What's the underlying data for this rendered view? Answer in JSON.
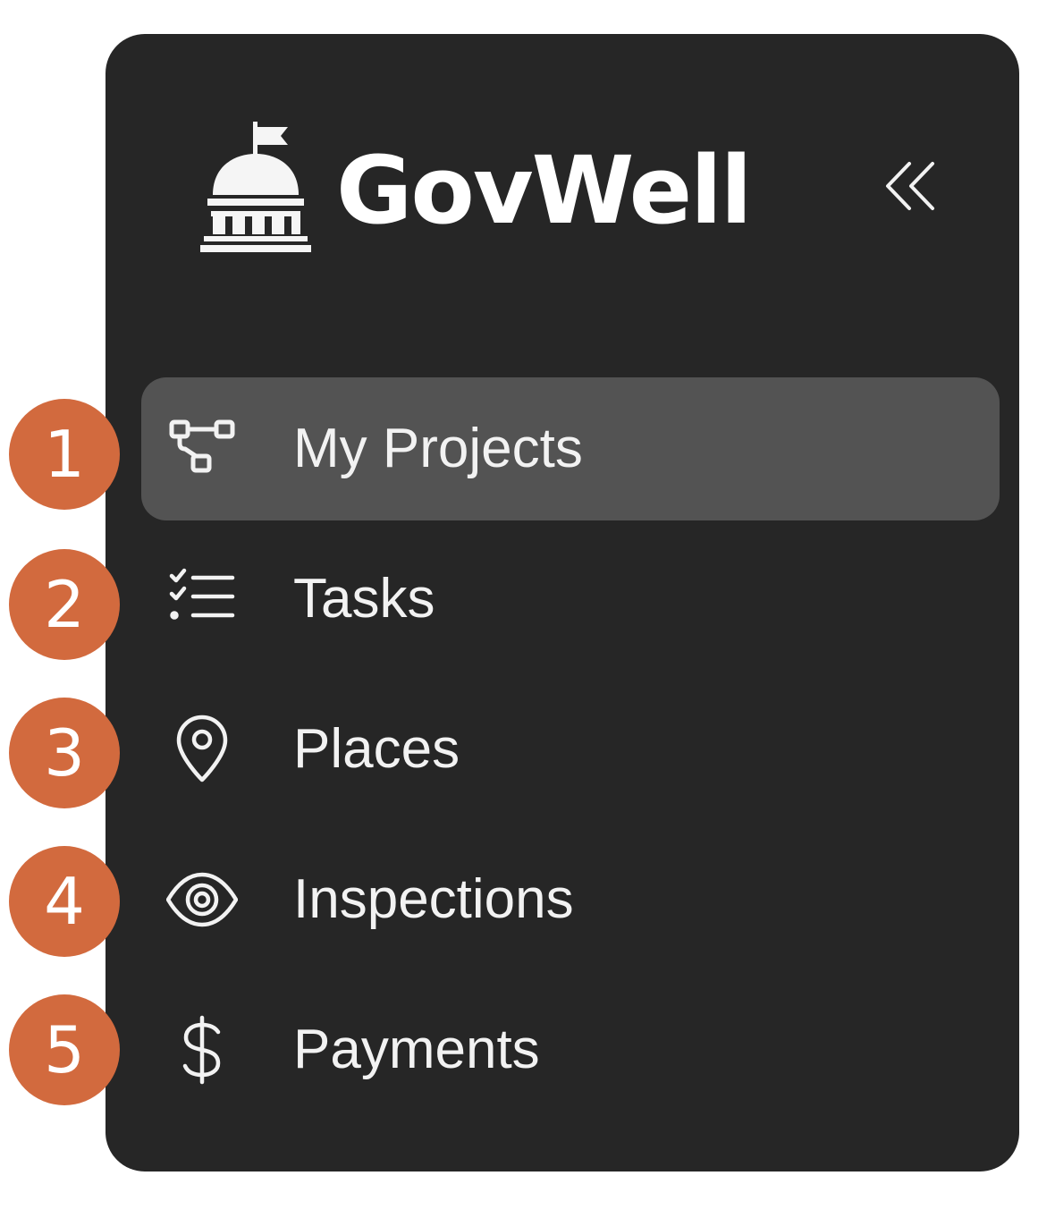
{
  "brand": {
    "name": "GovWell",
    "logo_icon": "capitol-building-icon"
  },
  "collapse": {
    "icon": "double-chevron-left-icon"
  },
  "nav": {
    "items": [
      {
        "label": "My Projects",
        "icon": "project-tree-icon",
        "active": true
      },
      {
        "label": "Tasks",
        "icon": "checklist-icon",
        "active": false
      },
      {
        "label": "Places",
        "icon": "map-pin-icon",
        "active": false
      },
      {
        "label": "Inspections",
        "icon": "eye-icon",
        "active": false
      },
      {
        "label": "Payments",
        "icon": "dollar-icon",
        "active": false
      }
    ]
  },
  "badges": [
    "1",
    "2",
    "3",
    "4",
    "5"
  ],
  "colors": {
    "sidebar_bg": "#262626",
    "active_item_bg": "#535353",
    "text": "#f2f2f2",
    "badge": "#d26a3e"
  }
}
